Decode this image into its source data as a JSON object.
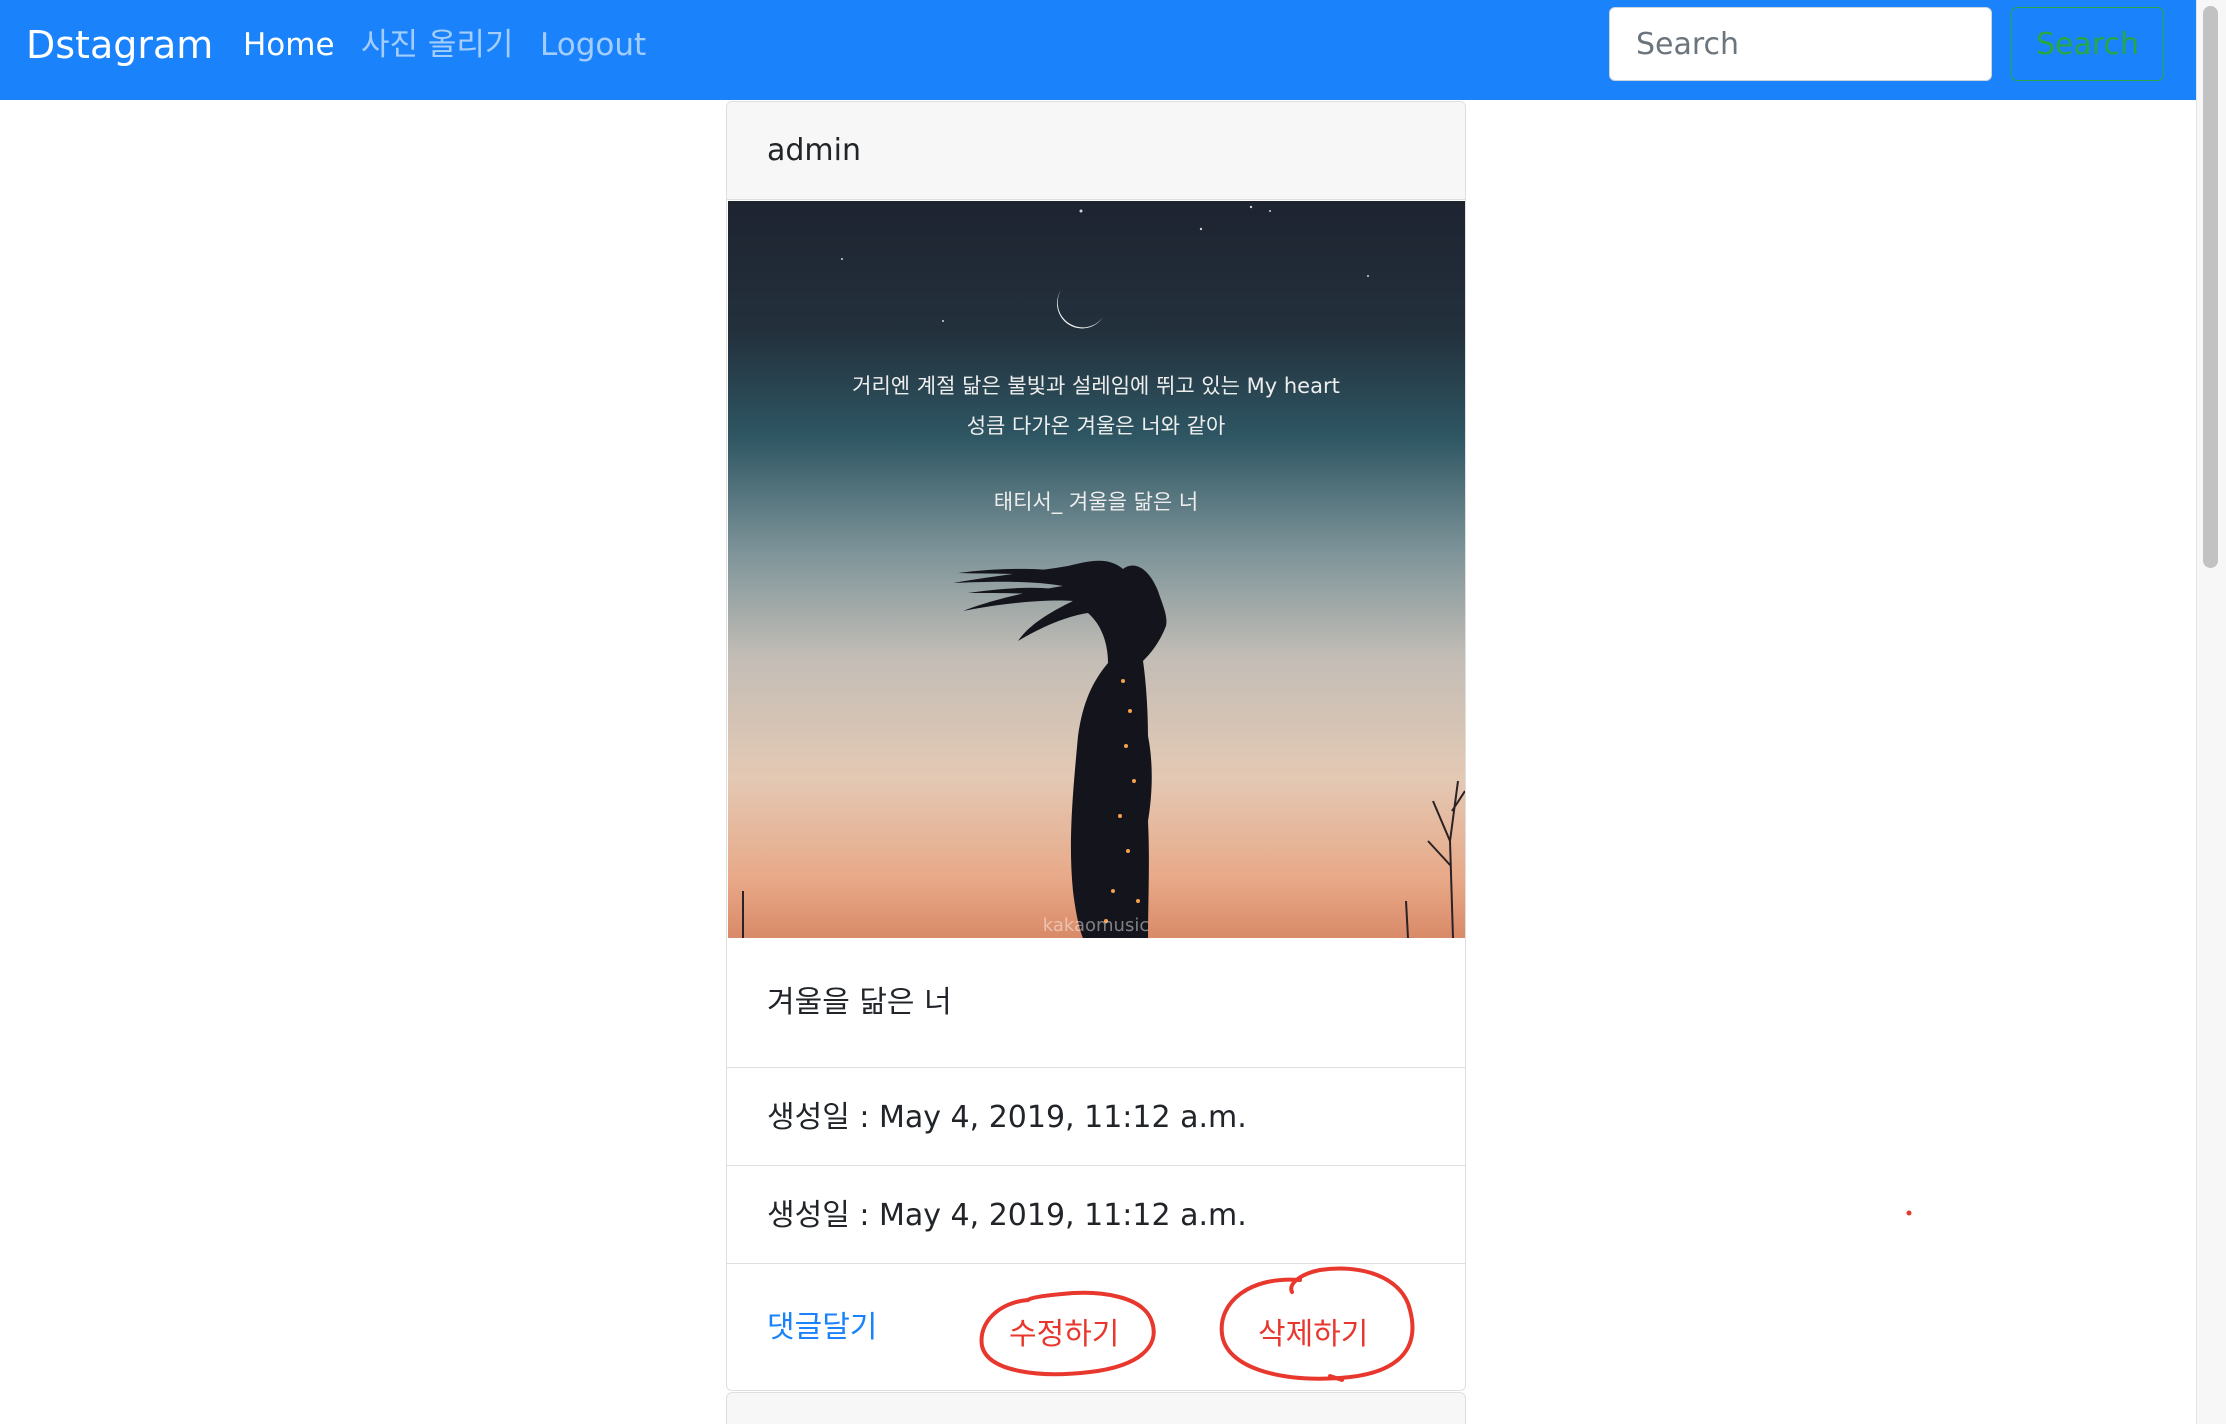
{
  "navbar": {
    "brand": "Dstagram",
    "links": [
      {
        "label": "Home"
      },
      {
        "label": "사진 올리기"
      },
      {
        "label": "Logout"
      }
    ],
    "search": {
      "placeholder": "Search",
      "button_label": "Search"
    }
  },
  "post": {
    "author": "admin",
    "image": {
      "lyric_line_1": "거리엔 계절 닮은 불빛과 설레임에 뛰고 있는 My heart",
      "lyric_line_2": "성큼 다가온 겨울은 너와 같아",
      "credit": "태티서_ 겨울을 닮은 너",
      "watermark": "kakaomusic"
    },
    "caption": "겨울을 닮은 너",
    "created": "생성일 : May 4, 2019, 11:12 a.m.",
    "updated": "생성일 : May 4, 2019, 11:12 a.m.",
    "actions": {
      "comment": "댓글달기",
      "edit": "수정하기",
      "delete": "삭제하기"
    }
  },
  "colors": {
    "navbar": "#1a82fb",
    "link": "#1a82fb",
    "search_button": "#28a745",
    "annotation": "#e8372d"
  }
}
